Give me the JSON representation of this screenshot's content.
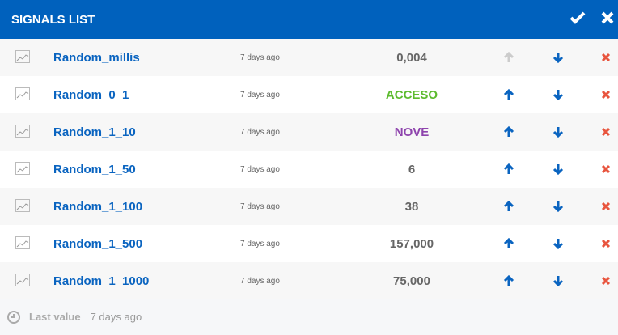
{
  "header": {
    "title": "SIGNALS LIST",
    "confirm_icon": "check-icon",
    "close_icon": "close-icon"
  },
  "colors": {
    "header": "#0061bd",
    "link": "#0a64c0",
    "green": "#5dbb2f",
    "purple": "#8e44ad",
    "gray": "#666666",
    "delete": "#e8553e",
    "disabled": "#cccccc"
  },
  "rows": [
    {
      "name": "Random_millis",
      "time": "7 days ago",
      "value": "0,004",
      "value_color": "#666666",
      "up_enabled": false
    },
    {
      "name": "Random_0_1",
      "time": "7 days ago",
      "value": "ACCESO",
      "value_color": "#5dbb2f",
      "up_enabled": true
    },
    {
      "name": "Random_1_10",
      "time": "7 days ago",
      "value": "NOVE",
      "value_color": "#8e44ad",
      "up_enabled": true
    },
    {
      "name": "Random_1_50",
      "time": "7 days ago",
      "value": "6",
      "value_color": "#666666",
      "up_enabled": true
    },
    {
      "name": "Random_1_100",
      "time": "7 days ago",
      "value": "38",
      "value_color": "#666666",
      "up_enabled": true
    },
    {
      "name": "Random_1_500",
      "time": "7 days ago",
      "value": "157,000",
      "value_color": "#666666",
      "up_enabled": true
    },
    {
      "name": "Random_1_1000",
      "time": "7 days ago",
      "value": "75,000",
      "value_color": "#666666",
      "up_enabled": true
    }
  ],
  "footer": {
    "label": "Last value",
    "time": "7 days ago"
  }
}
